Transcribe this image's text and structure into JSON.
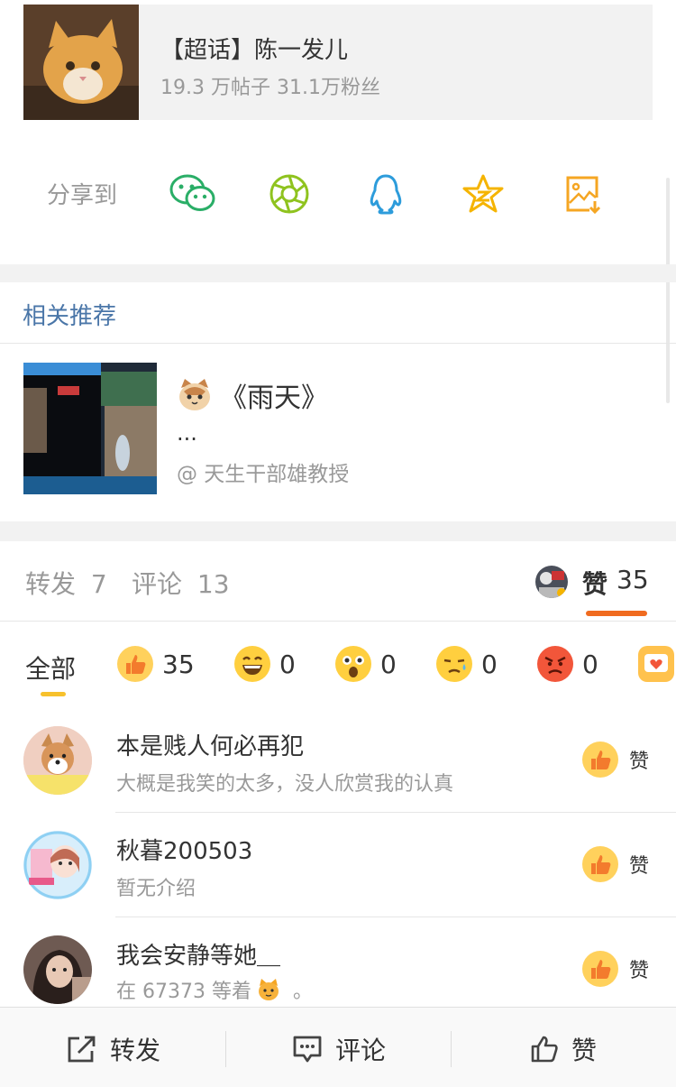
{
  "topic": {
    "title": "【超话】陈一发儿",
    "stats": "19.3 万帖子 31.1万粉丝"
  },
  "share": {
    "label": "分享到",
    "targets": [
      {
        "icon": "wechat-icon",
        "color": "#2aae67"
      },
      {
        "icon": "moments-icon",
        "color": "#8fc31f"
      },
      {
        "icon": "qq-icon",
        "color": "#2d9cdb"
      },
      {
        "icon": "qzone-icon",
        "color": "#f5b400"
      },
      {
        "icon": "save-image-icon",
        "color": "#f5a623"
      }
    ]
  },
  "related": {
    "title": "相关推荐",
    "item": {
      "title": "《雨天》",
      "desc": "...",
      "author": "@ 天生干部雄教授"
    }
  },
  "tabs": {
    "repost_label": "转发",
    "repost_count": "7",
    "comment_label": "评论",
    "comment_count": "13",
    "like_label": "赞",
    "like_count": "35"
  },
  "filters": {
    "all_label": "全部",
    "reactions": [
      {
        "icon": "thumbs-up-emoji-icon",
        "count": "35"
      },
      {
        "icon": "laughing-emoji-icon",
        "count": "0"
      },
      {
        "icon": "surprised-emoji-icon",
        "count": "0"
      },
      {
        "icon": "sad-emoji-icon",
        "count": "0"
      },
      {
        "icon": "angry-emoji-icon",
        "count": "0"
      }
    ]
  },
  "users": [
    {
      "name": "本是贱人何必再犯",
      "bio": "大概是我笑的太多，没人欣赏我的认真",
      "action": "赞"
    },
    {
      "name": "秋暮200503",
      "bio": "暂无介绍",
      "action": "赞"
    },
    {
      "name": "我会安静等她＿",
      "bio": "在 67373 等着",
      "bio_suffix": "。",
      "action": "赞"
    }
  ],
  "bottom": {
    "repost": "转发",
    "comment": "评论",
    "like": "赞"
  },
  "colors": {
    "accent": "#f06b1f",
    "link": "#4a76a8",
    "underline_yellow": "#f7c12c"
  }
}
